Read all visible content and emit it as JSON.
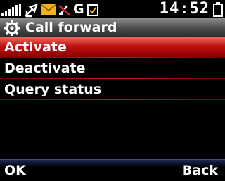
{
  "statusbar": {
    "icons": [
      "signal-icon",
      "data-transfer-icon",
      "envelope-icon",
      "mute-icon",
      "g-network-icon",
      "calendar-note-icon"
    ],
    "network_label": "G",
    "time": "14:52",
    "battery": "battery-icon"
  },
  "header": {
    "title": "Call forward",
    "icon": "gear-icon"
  },
  "menu": {
    "items": [
      {
        "label": "Activate",
        "selected": true
      },
      {
        "label": "Deactivate",
        "selected": false
      },
      {
        "label": "Query status",
        "selected": false
      }
    ]
  },
  "softkeys": {
    "left": "OK",
    "right": "Back"
  },
  "colors": {
    "selection": "#c21010",
    "titlebar": "#5a5a5a",
    "softbar": "#1b2a55"
  }
}
